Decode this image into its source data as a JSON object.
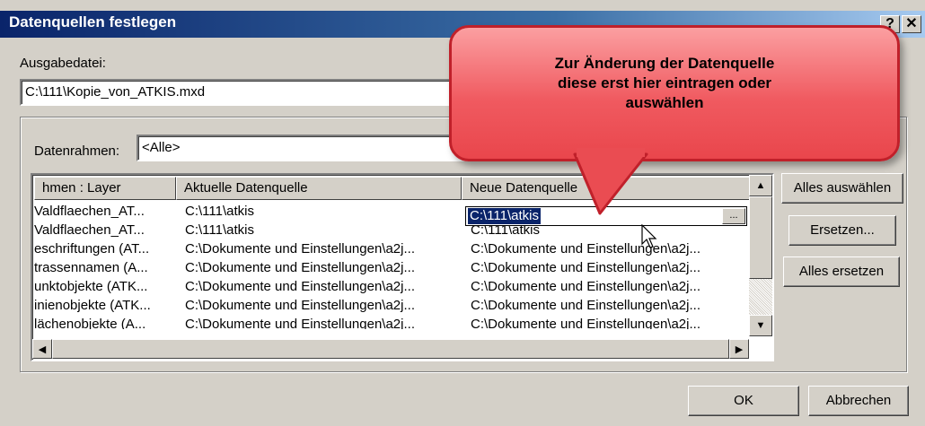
{
  "window": {
    "title": "Datenquellen festlegen",
    "help_button": "?",
    "close_button": "✕"
  },
  "output": {
    "label": "Ausgabedatei:",
    "value": "C:\\111\\Kopie_von_ATKIS.mxd"
  },
  "dataframe": {
    "label": "Datenrahmen:",
    "value": "<Alle>"
  },
  "callout": {
    "lines": [
      "Zur Änderung der Datenquelle",
      "diese erst hier eintragen oder",
      "auswählen"
    ]
  },
  "table": {
    "columns": [
      "hmen : Layer",
      "Aktuelle Datenquelle",
      "Neue Datenquelle"
    ],
    "rows": [
      [
        "Valdflaechen_AT...",
        "C:\\111\\atkis",
        "C:\\111\\atkis"
      ],
      [
        "Valdflaechen_AT...",
        "C:\\111\\atkis",
        "C:\\111\\atkis"
      ],
      [
        "eschriftungen (AT...",
        "C:\\Dokumente und Einstellungen\\a2j...",
        "C:\\Dokumente und Einstellungen\\a2j..."
      ],
      [
        "trassennamen (A...",
        "C:\\Dokumente und Einstellungen\\a2j...",
        "C:\\Dokumente und Einstellungen\\a2j..."
      ],
      [
        "unktobjekte (ATK...",
        "C:\\Dokumente und Einstellungen\\a2j...",
        "C:\\Dokumente und Einstellungen\\a2j..."
      ],
      [
        "inienobjekte (ATK...",
        "C:\\Dokumente und Einstellungen\\a2j...",
        "C:\\Dokumente und Einstellungen\\a2j..."
      ],
      [
        "lächenobjekte (A...",
        "C:\\Dokumente und Einstellungen\\a2j...",
        "C:\\Dokumente und Einstellungen\\a2j..."
      ]
    ],
    "browse_label": "...",
    "scroll_up": "▲",
    "scroll_down": "▼",
    "scroll_left": "◀",
    "scroll_right": "▶"
  },
  "buttons": {
    "select_all": "Alles auswählen",
    "replace": "Ersetzen...",
    "replace_all": "Alles ersetzen",
    "ok": "OK",
    "cancel": "Abbrechen"
  },
  "icons": {
    "cursor": "mouse-pointer-icon"
  }
}
